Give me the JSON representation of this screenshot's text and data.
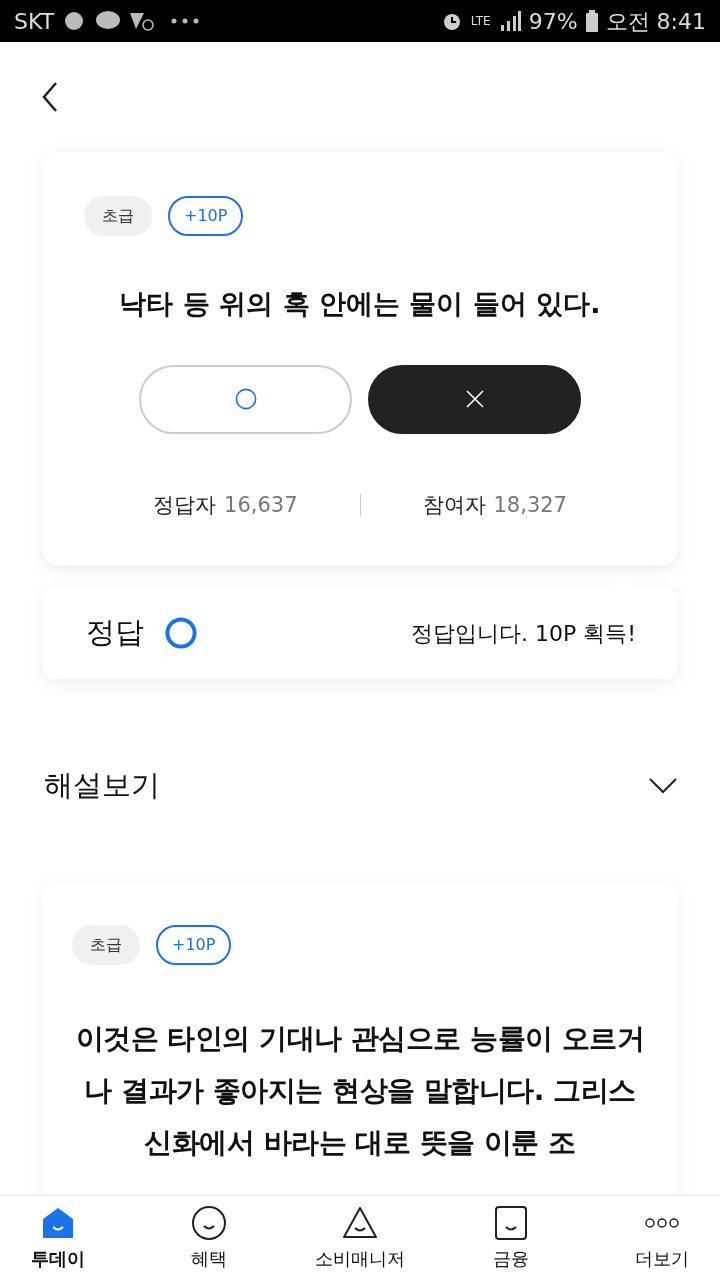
{
  "status_bar": {
    "carrier": "SKT",
    "network": "LTE",
    "battery": "97%",
    "time": "오전 8:41"
  },
  "quiz": {
    "level": "초급",
    "points": "+10P",
    "question": "낙타 등 위의 혹 안에는 물이 들어 있다.",
    "choices": [
      {
        "kind": "o",
        "selected": false
      },
      {
        "kind": "x",
        "selected": true
      }
    ],
    "stats": [
      {
        "label": "정답자",
        "value": "16,637"
      },
      {
        "label": "참여자",
        "value": "18,327"
      }
    ]
  },
  "answer": {
    "label": "정답",
    "kind": "o",
    "message": "정답입니다. 10P 획득!"
  },
  "explanation": {
    "label": "해설보기",
    "expanded": false
  },
  "next_quiz": {
    "level": "초급",
    "points": "+10P",
    "text": "이것은 타인의 기대나 관심으로 능률이 오르거나 결과가 좋아지는 현상을 말합니다. 그리스 신화에서 바라는 대로 뜻을 이룬 조"
  },
  "bottom_nav": [
    {
      "label": "투데이",
      "kind": "home",
      "selected": true
    },
    {
      "label": "혜택",
      "kind": "circle",
      "selected": false
    },
    {
      "label": "소비매니저",
      "kind": "triangle",
      "selected": false
    },
    {
      "label": "금융",
      "kind": "square",
      "selected": false
    },
    {
      "label": "더보기",
      "kind": "more",
      "selected": false
    }
  ]
}
